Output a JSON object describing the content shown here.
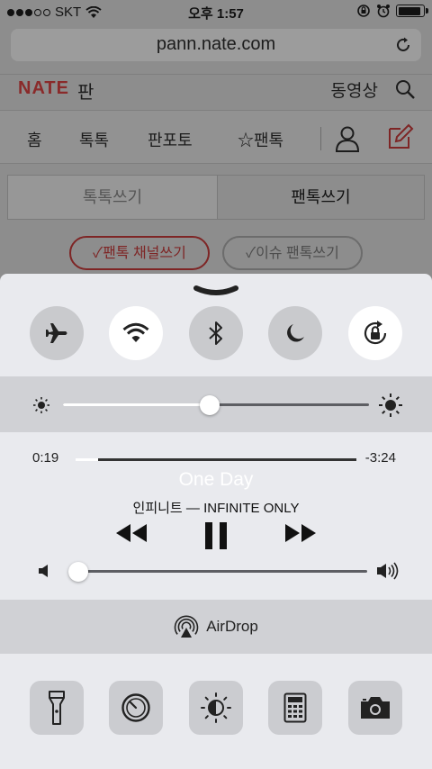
{
  "status_bar": {
    "carrier": "SKT",
    "time": "오후 1:57",
    "signal_bars": 3,
    "battery_level": 0.9
  },
  "browser": {
    "url": "pann.nate.com"
  },
  "site_header": {
    "logo": "NATE",
    "section": "판",
    "video_link": "동영상"
  },
  "site_nav": {
    "items": [
      "홈",
      "톡톡",
      "판포토",
      "☆팬톡"
    ]
  },
  "write_tabs": {
    "left": "톡톡쓰기",
    "right": "팬톡쓰기"
  },
  "channel_buttons": {
    "primary": "✓팬톡 채널쓰기",
    "secondary": "✓이슈 팬톡쓰기"
  },
  "control_center": {
    "toggles": [
      {
        "name": "airplane-mode",
        "icon": "airplane-icon",
        "on": false
      },
      {
        "name": "wifi",
        "icon": "wifi-icon",
        "on": true
      },
      {
        "name": "bluetooth",
        "icon": "bluetooth-icon",
        "on": false
      },
      {
        "name": "do-not-disturb",
        "icon": "moon-icon",
        "on": false
      },
      {
        "name": "rotation-lock",
        "icon": "rotation-lock-icon",
        "on": true
      }
    ],
    "brightness_level": 0.48,
    "now_playing": {
      "elapsed": "0:19",
      "remaining": "-3:24",
      "progress": 0.08,
      "title": "One Day",
      "artist_album": "인피니트 — INFINITE ONLY"
    },
    "volume_level": 0.02,
    "airdrop_label": "AirDrop",
    "shortcuts": [
      "flashlight-icon",
      "timer-icon",
      "night-shift-icon",
      "calculator-icon",
      "camera-icon"
    ]
  }
}
